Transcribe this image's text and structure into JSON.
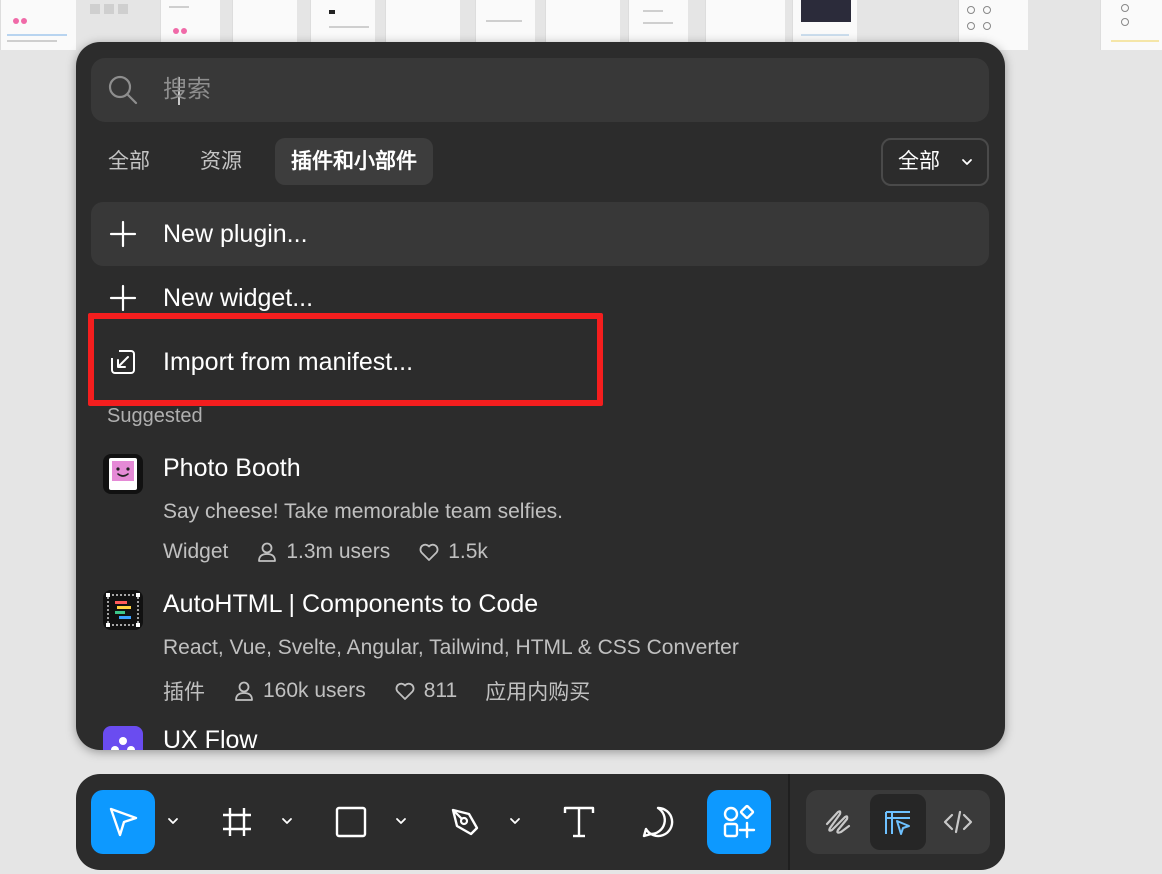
{
  "search": {
    "placeholder": "搜索",
    "value": ""
  },
  "tabs": [
    {
      "label": "全部"
    },
    {
      "label": "资源"
    },
    {
      "label": "插件和小部件",
      "active": true
    }
  ],
  "filter": {
    "label": "全部"
  },
  "actions": {
    "new_plugin": "New plugin...",
    "new_widget": "New widget...",
    "import_manifest": "Import from manifest..."
  },
  "section_label": "Suggested",
  "items": [
    {
      "name": "Photo Booth",
      "description": "Say cheese! Take memorable team selfies.",
      "type": "Widget",
      "users": "1.3m users",
      "likes": "1.5k",
      "icon": "photo-booth-logo"
    },
    {
      "name": "AutoHTML | Components to Code",
      "description": "React, Vue, Svelte, Angular, Tailwind, HTML & CSS Converter",
      "type": "插件",
      "users": "160k users",
      "likes": "811",
      "extra": "应用内购买",
      "icon": "autohtml-logo"
    },
    {
      "name": "UX Flow",
      "icon": "ux-flow-logo"
    }
  ],
  "toolbar": {
    "tools": [
      "move-tool",
      "frame-tool",
      "shape-tool",
      "pen-tool",
      "text-tool",
      "comment-tool",
      "actions-tool"
    ],
    "modes": [
      "draw-mode",
      "design-mode",
      "dev-mode"
    ]
  },
  "colors": {
    "accent": "#0d99ff",
    "highlight": "#f41e1e",
    "panel": "#2c2c2c"
  }
}
